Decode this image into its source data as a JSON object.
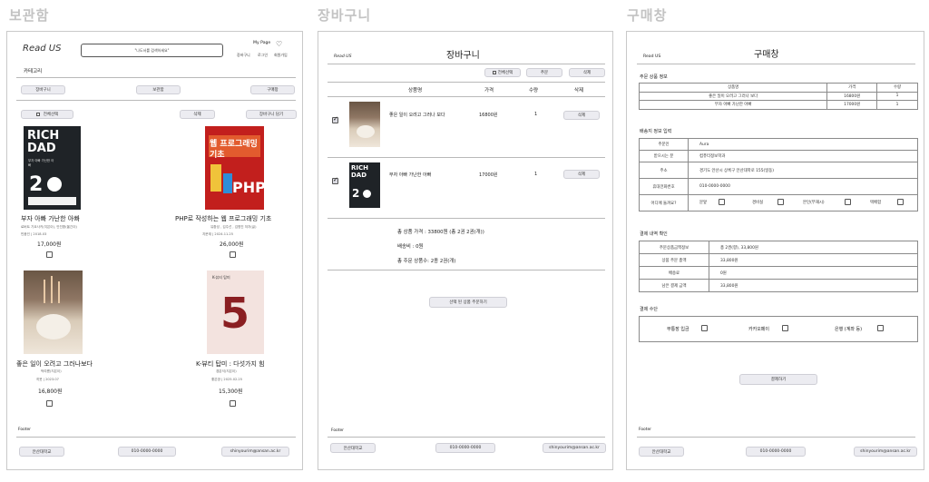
{
  "sections": {
    "storage": "보관함",
    "cart": "장바구니",
    "purchase": "구매창"
  },
  "storage": {
    "logo": "Read US",
    "search_placeholder": "\"나도서를 검색하세요\"",
    "mypage": "My Page",
    "nav": [
      "장바구니",
      "로그인",
      "회원가입"
    ],
    "category": "카테고리",
    "tabs": [
      "장바구니",
      "보관함",
      "구매창"
    ],
    "select_all": "전체선택",
    "delete": "삭제",
    "add_cart": "장바구니 담기",
    "books": [
      {
        "title": "부자 아빠 가난한 아빠",
        "meta1": "로버트 기요사키(지은이), 안진환(옮긴이)",
        "meta2": "민음인 | 2018.03",
        "price": "17,000원"
      },
      {
        "title": "PHP로 작성하는 웹 프로그래밍 기초",
        "meta1": "유환성 , 김주선 , 김명진 저자(글)",
        "meta2": "지문재 | 2024.11.25",
        "price": "26,000원"
      },
      {
        "title": "좋은 일이 오려고 그러나보다",
        "meta1": "박여름(지은이)",
        "meta2": "히읏 | 2023.07",
        "price": "16,800원"
      },
      {
        "title": "K-뷰티 탑미 : 다섯가지 힘",
        "meta1": "경분석(지은이)",
        "meta2": "좋은땅 | 2025.02.25",
        "price": "15,300원"
      }
    ],
    "cover_texts": {
      "rich1": "RICH",
      "rich2": "DAD",
      "rich_sub": "부자 아빠 가난한 아빠",
      "rich_num": "2",
      "php_top": "웹 프로그래밍",
      "php_mid": "기초",
      "php_big": "PHP",
      "k_top": "K-뷰티 탑미",
      "k_num": "5"
    },
    "footer": "Footer",
    "footer_items": [
      "안산대학교",
      "010-0000-0000",
      "shinyourim@ansan.ac.kr"
    ]
  },
  "cart": {
    "title": "장바구니",
    "logo": "Read US",
    "buttons": [
      "전체선택",
      "추문",
      "삭제"
    ],
    "headers": [
      "상품명",
      "가격",
      "수량",
      "삭제"
    ],
    "items": [
      {
        "name": "좋은 일이 오려고 그러나 보다",
        "price": "16800원",
        "qty": "1",
        "delete": "삭제"
      },
      {
        "name": "부자 아빠 가난한 아빠",
        "price": "17000원",
        "qty": "1",
        "delete": "삭제"
      }
    ],
    "summary": [
      "총 상품 가격 : 33800원 (총 2권 2권(개))",
      "배송비 : 0원",
      "총 주문 상품수: 2종 2권(개)"
    ],
    "order_button": "선택 된 상품 주문하기",
    "footer": "Footer",
    "footer_items": [
      "안산대학교",
      "010-0000-0000",
      "shinyourim@ansan.ac.kr"
    ]
  },
  "purchase": {
    "title": "구매창",
    "logo": "Read US",
    "order_info_label": "주문 상품 정보",
    "order_headers": [
      "상품명",
      "가격",
      "수량"
    ],
    "order_rows": [
      {
        "name": "좋은 일이 오려고 그러나 보다",
        "price": "16800원",
        "qty": "1"
      },
      {
        "name": "부자 아빠 가난한 아빠",
        "price": "17000원",
        "qty": "1"
      }
    ],
    "ship_label": "배송지 정보 입력",
    "ship_rows": [
      {
        "k": "주문인",
        "v": "Aura"
      },
      {
        "k": "받으시는 분",
        "v": "컴퓨터정보학과"
      },
      {
        "k": "주소",
        "v": "경기도 안산시 상록구 안산대학로 155(일동)"
      },
      {
        "k": "휴대전화번호",
        "v": "010-0000-0000"
      }
    ],
    "where_label": "어디에 둘까요?",
    "where_opts": [
      "문앞",
      "경비실",
      "본인(부재시)",
      "택배함"
    ],
    "confirm_label": "결제 내역 확인",
    "confirm_rows": [
      {
        "k": "주문상품금액정보",
        "v": "총 2권(향), 33,800원"
      },
      {
        "k": "상품 주문 총액",
        "v": "33,800원"
      },
      {
        "k": "배송료",
        "v": "0원"
      },
      {
        "k": "남은 결제 금액",
        "v": "33,800원"
      }
    ],
    "method_label": "결제 수단",
    "methods": [
      "무통장 입금",
      "카카오페이",
      "은행 (계좌 등)"
    ],
    "pay_button": "결제하기",
    "footer": "Footer",
    "footer_items": [
      "안산대학교",
      "010-0000-0000",
      "shinyourim@ansan.ac.kr"
    ]
  }
}
